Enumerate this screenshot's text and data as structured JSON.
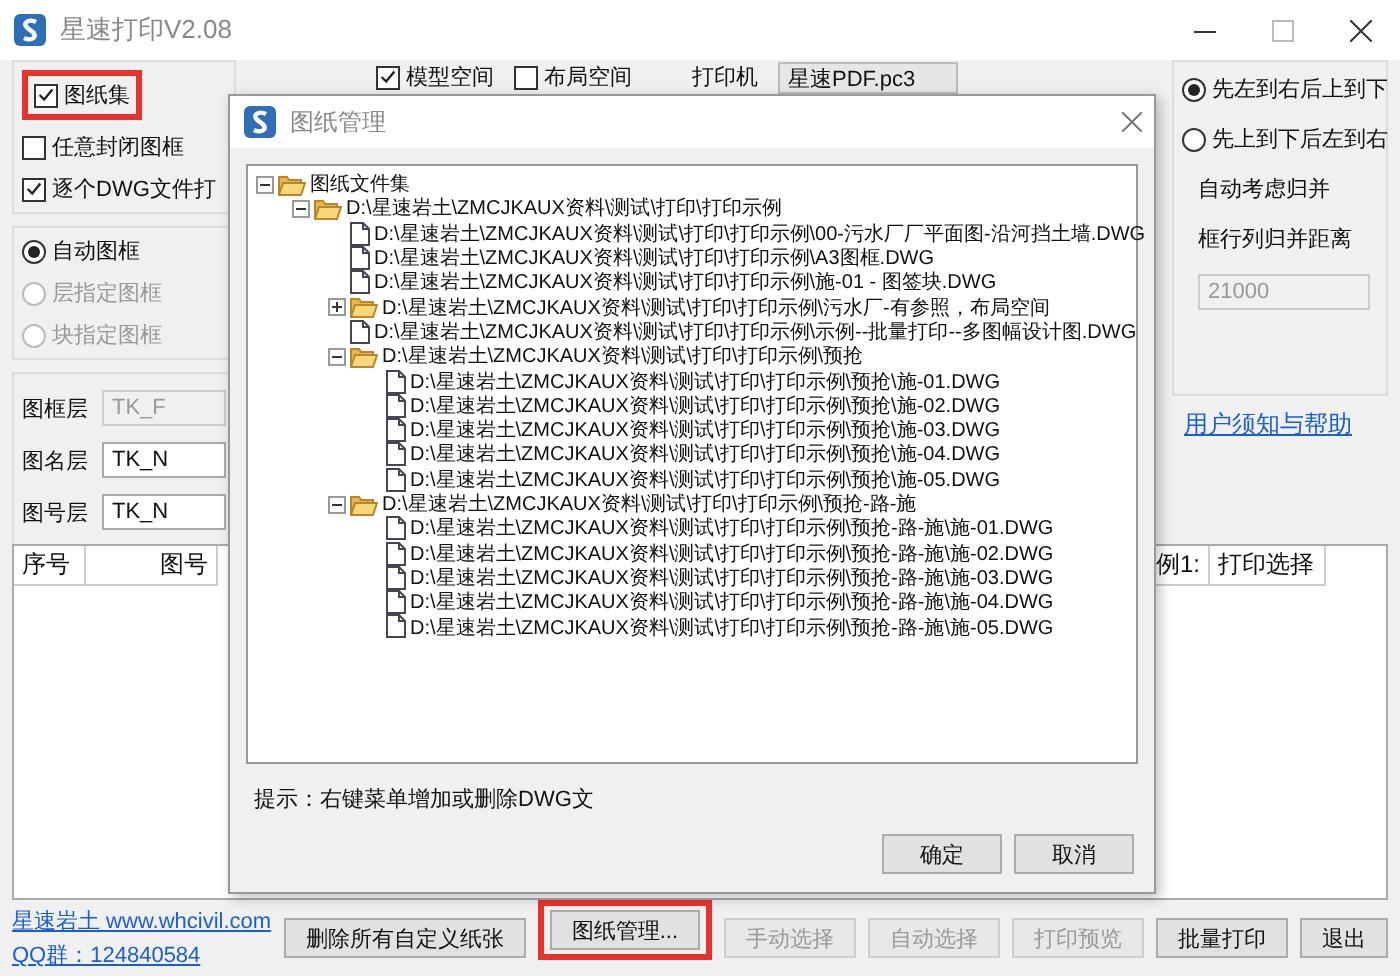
{
  "window": {
    "title": "星速打印V2.08"
  },
  "options": [
    {
      "label": "图纸集",
      "checked": true,
      "highlighted": true
    },
    {
      "label": "任意封闭图框",
      "checked": false,
      "highlighted": false
    },
    {
      "label": "逐个DWG文件打",
      "checked": true,
      "highlighted": false
    }
  ],
  "space_options": [
    {
      "label": "模型空间",
      "checked": true
    },
    {
      "label": "布局空间",
      "checked": false
    }
  ],
  "printer": {
    "label": "打印机",
    "value": "星速PDF.pc3"
  },
  "frame_modes": [
    {
      "label": "自动图框",
      "selected": true,
      "disabled": false
    },
    {
      "label": "层指定图框",
      "selected": false,
      "disabled": true
    },
    {
      "label": "块指定图框",
      "selected": false,
      "disabled": true
    }
  ],
  "layers": [
    {
      "label": "图框层",
      "value": "TK_F",
      "disabled": true
    },
    {
      "label": "图名层",
      "value": "TK_N",
      "disabled": false
    },
    {
      "label": "图号层",
      "value": "TK_N",
      "disabled": false
    }
  ],
  "order": [
    {
      "label": "先左到右后上到下",
      "selected": true
    },
    {
      "label": "先上到下后左到右",
      "selected": false
    }
  ],
  "merge": {
    "label": "自动考虑归并"
  },
  "merge_distance": {
    "label": "框行列归并距离",
    "value": "21000",
    "disabled": true
  },
  "help_link": "用户须知与帮助",
  "table": {
    "columns": [
      "序号",
      "图号",
      "例1:",
      "打印选择"
    ]
  },
  "footer": {
    "site_link": "星速岩土 www.whcivil.com",
    "qq_link": "QQ群：124840584",
    "buttons": [
      {
        "label": "删除所有自定义纸张",
        "disabled": false,
        "highlighted": false
      },
      {
        "label": "图纸管理...",
        "disabled": false,
        "highlighted": true
      },
      {
        "label": "手动选择",
        "disabled": true,
        "highlighted": false
      },
      {
        "label": "自动选择",
        "disabled": true,
        "highlighted": false
      },
      {
        "label": "打印预览",
        "disabled": true,
        "highlighted": false
      },
      {
        "label": "批量打印",
        "disabled": false,
        "highlighted": false
      },
      {
        "label": "退出",
        "disabled": false,
        "highlighted": false
      }
    ]
  },
  "dialog": {
    "title": "图纸管理",
    "tree": [
      {
        "kind": "folder",
        "label": "图纸文件集",
        "expanded": true,
        "children": [
          {
            "kind": "folder",
            "label": "D:\\星速岩土\\ZMCJKAUX资料\\测试\\打印\\打印示例",
            "expanded": true,
            "children": [
              {
                "kind": "file",
                "label": "D:\\星速岩土\\ZMCJKAUX资料\\测试\\打印\\打印示例\\00-污水厂厂平面图-沿河挡土墙.DWG"
              },
              {
                "kind": "file",
                "label": "D:\\星速岩土\\ZMCJKAUX资料\\测试\\打印\\打印示例\\A3图框.DWG"
              },
              {
                "kind": "file",
                "label": "D:\\星速岩土\\ZMCJKAUX资料\\测试\\打印\\打印示例\\施-01 - 图签块.DWG"
              },
              {
                "kind": "folder",
                "label": "D:\\星速岩土\\ZMCJKAUX资料\\测试\\打印\\打印示例\\污水厂-有参照，布局空间",
                "expanded": false
              },
              {
                "kind": "file",
                "label": "D:\\星速岩土\\ZMCJKAUX资料\\测试\\打印\\打印示例\\示例--批量打印--多图幅设计图.DWG"
              },
              {
                "kind": "folder",
                "label": "D:\\星速岩土\\ZMCJKAUX资料\\测试\\打印\\打印示例\\预抢",
                "expanded": true,
                "children": [
                  {
                    "kind": "file",
                    "label": "D:\\星速岩土\\ZMCJKAUX资料\\测试\\打印\\打印示例\\预抢\\施-01.DWG"
                  },
                  {
                    "kind": "file",
                    "label": "D:\\星速岩土\\ZMCJKAUX资料\\测试\\打印\\打印示例\\预抢\\施-02.DWG"
                  },
                  {
                    "kind": "file",
                    "label": "D:\\星速岩土\\ZMCJKAUX资料\\测试\\打印\\打印示例\\预抢\\施-03.DWG"
                  },
                  {
                    "kind": "file",
                    "label": "D:\\星速岩土\\ZMCJKAUX资料\\测试\\打印\\打印示例\\预抢\\施-04.DWG"
                  },
                  {
                    "kind": "file",
                    "label": "D:\\星速岩土\\ZMCJKAUX资料\\测试\\打印\\打印示例\\预抢\\施-05.DWG"
                  }
                ]
              },
              {
                "kind": "folder",
                "label": "D:\\星速岩土\\ZMCJKAUX资料\\测试\\打印\\打印示例\\预抢-路-施",
                "expanded": true,
                "children": [
                  {
                    "kind": "file",
                    "label": "D:\\星速岩土\\ZMCJKAUX资料\\测试\\打印\\打印示例\\预抢-路-施\\施-01.DWG"
                  },
                  {
                    "kind": "file",
                    "label": "D:\\星速岩土\\ZMCJKAUX资料\\测试\\打印\\打印示例\\预抢-路-施\\施-02.DWG"
                  },
                  {
                    "kind": "file",
                    "label": "D:\\星速岩土\\ZMCJKAUX资料\\测试\\打印\\打印示例\\预抢-路-施\\施-03.DWG"
                  },
                  {
                    "kind": "file",
                    "label": "D:\\星速岩土\\ZMCJKAUX资料\\测试\\打印\\打印示例\\预抢-路-施\\施-04.DWG"
                  },
                  {
                    "kind": "file",
                    "label": "D:\\星速岩土\\ZMCJKAUX资料\\测试\\打印\\打印示例\\预抢-路-施\\施-05.DWG"
                  }
                ]
              }
            ]
          }
        ]
      }
    ],
    "hint": "提示：右键菜单增加或删除DWG文",
    "buttons": [
      "确定",
      "取消"
    ]
  }
}
